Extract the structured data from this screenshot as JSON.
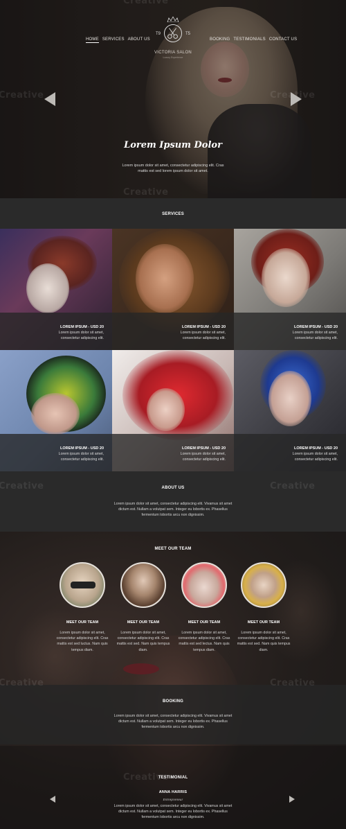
{
  "nav": {
    "left": [
      {
        "label": "HOME",
        "active": true
      },
      {
        "label": "SERVICES",
        "active": false
      },
      {
        "label": "ABOUT US",
        "active": false
      }
    ],
    "right": [
      {
        "label": "BOOKING",
        "active": false
      },
      {
        "label": "TESTIMONIALS",
        "active": false
      },
      {
        "label": "CONTACT US",
        "active": false
      }
    ]
  },
  "logo": {
    "year_left": "T9",
    "year_right": "T5",
    "name": "VICTORIA SALON",
    "tagline": "Luxury Experience"
  },
  "hero": {
    "title": "Lorem Ipsum Dolor",
    "text": "Lorem ipsum dolor sit amet, consectetur adipiscing elit. Cras mattis est sed lorem ipsum dolor sit amet."
  },
  "watermark": "Creative",
  "services": {
    "title": "SERVICES",
    "items": [
      {
        "title": "LOREM IPSUM - USD 20",
        "text": "Lorem ipsum dolor sit amet, consectetur adipiscing elit."
      },
      {
        "title": "LOREM IPSUM - USD 20",
        "text": "Lorem ipsum dolor sit amet, consectetur adipiscing elit."
      },
      {
        "title": "LOREM IPSUM - USD 20",
        "text": "Lorem ipsum dolor sit amet, consectetur adipiscing elit."
      },
      {
        "title": "LOREM IPSUM - USD 20",
        "text": "Lorem ipsum dolor sit amet, consectetur adipiscing elit."
      },
      {
        "title": "LOREM IPSUM - USD 20",
        "text": "Lorem ipsum dolor sit amet, consectetur adipiscing elit."
      },
      {
        "title": "LOREM IPSUM - USD 20",
        "text": "Lorem ipsum dolor sit amet, consectetur adipiscing elit."
      }
    ]
  },
  "about": {
    "title": "ABOUT US",
    "text": "Lorem ipsum dolor sit amet, consectetur adipiscing elit. Vivamus sit amet dictum est. Nullam a volutpat sem. Integer eu lobortis ex. Phasellus fermentum lobortis arcu non dignissim."
  },
  "team": {
    "title": "MEET OUR TEAM",
    "members": [
      {
        "name": "MEET OUR TEAM",
        "text": "Lorem ipsum dolor sit amet, consectetur adipiscing elit. Cras mattis est sed luctus. Nam quis tempus diam."
      },
      {
        "name": "MEET OUR TEAM",
        "text": "Lorem ipsum dolor sit amet, consectetur adipiscing elit. Cras mattis est sed. Nam quis tempus diam."
      },
      {
        "name": "MEET OUR TEAM",
        "text": "Lorem ipsum dolor sit amet, consectetur adipiscing elit. Cras mattis est sed lectus. Nam quis tempus diam."
      },
      {
        "name": "MEET OUR TEAM",
        "text": "Lorem ipsum dolor sit amet, consectetur adipiscing elit. Cras mattis est sed. Nam quis tempus diam."
      }
    ]
  },
  "booking": {
    "title": "BOOKING",
    "text": "Lorem ipsum dolor sit amet, consectetur adipiscing elit. Vivamus sit amet dictum est. Nullam a volutpat sem. Integer eu lobortis ex. Phasellus fermentum lobortis arcu non dignissim."
  },
  "testimonial": {
    "title": "TESTIMONIAL",
    "name": "ANNA HARRIS",
    "role": "Entrepreneur",
    "text": "Lorem ipsum dolor sit amet, consectetur adipiscing elit. Vivamus sit amet dictum est. Nullam a volutpat sem. Integer eu lobortis ex. Phasellus fermentum lobortis arcu non dignissim."
  }
}
